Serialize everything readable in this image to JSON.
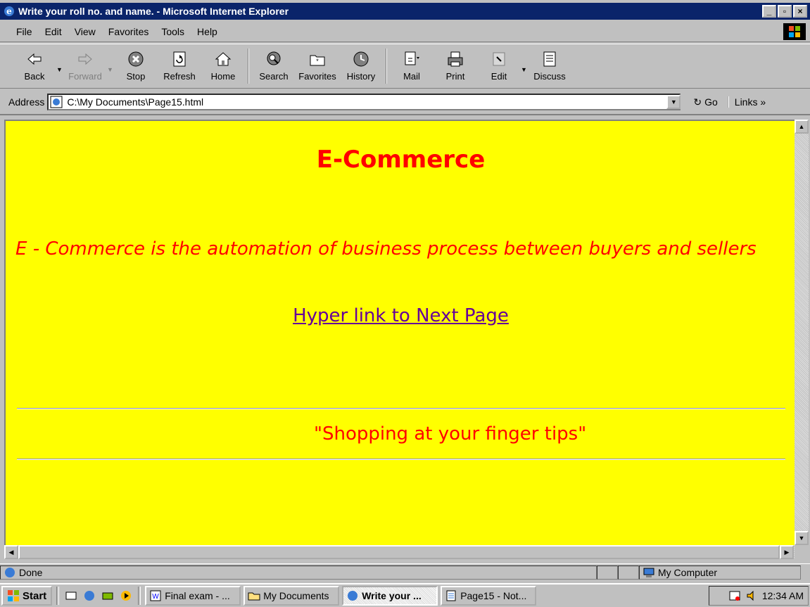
{
  "window": {
    "title": "Write your roll no. and name. - Microsoft Internet Explorer",
    "controls": [
      "_",
      "▫",
      "×"
    ]
  },
  "menu": [
    "File",
    "Edit",
    "View",
    "Favorites",
    "Tools",
    "Help"
  ],
  "toolbar": {
    "back": "Back",
    "forward": "Forward",
    "stop": "Stop",
    "refresh": "Refresh",
    "home": "Home",
    "search": "Search",
    "favorites": "Favorites",
    "history": "History",
    "mail": "Mail",
    "print": "Print",
    "edit": "Edit",
    "discuss": "Discuss"
  },
  "address": {
    "label": "Address",
    "value": "C:\\My Documents\\Page15.html",
    "go": "Go",
    "links": "Links »"
  },
  "page": {
    "heading": "E-Commerce",
    "paragraph": "E - Commerce is the automation of business process between buyers and sellers",
    "link": "Hyper link to Next Page",
    "slogan": "\"Shopping at your finger tips\"",
    "background": "#ffff00",
    "text_color": "#ff0000",
    "link_color": "#660099"
  },
  "status": {
    "text": "Done",
    "zone": "My Computer"
  },
  "taskbar": {
    "start": "Start",
    "tasks": [
      "Final exam - ...",
      "My Documents",
      "Write your ...",
      "Page15 - Not..."
    ],
    "clock": "12:34 AM"
  }
}
